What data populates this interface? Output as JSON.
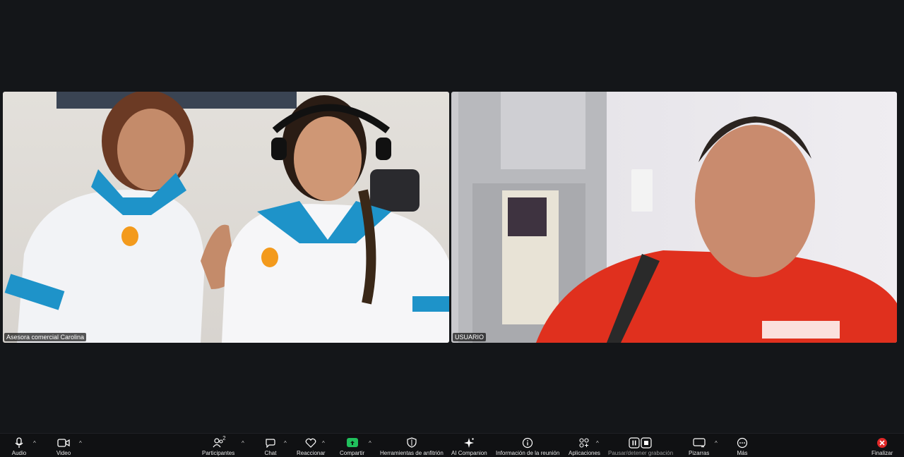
{
  "participants_video": [
    {
      "name_tag": "Asesora comercial Carolina"
    },
    {
      "name_tag": "USUARIO"
    }
  ],
  "toolbar": {
    "audio_label": "Audio",
    "video_label": "Video",
    "participants_label": "Participantes",
    "participants_count": "2",
    "chat_label": "Chat",
    "react_label": "Reaccionar",
    "share_label": "Compartir",
    "host_tools_label": "Herramientas de anfitrión",
    "ai_label": "AI Companion",
    "meeting_info_label": "Información de la reunión",
    "apps_label": "Aplicaciones",
    "record_label": "Pausar/detener grabación",
    "whiteboards_label": "Pizarras",
    "more_label": "Más",
    "end_label": "Finalizar",
    "caret": "^"
  },
  "colors": {
    "background": "#141619",
    "toolbar": "#101113",
    "share_accent": "#20c05c",
    "end_accent": "#e02828"
  }
}
